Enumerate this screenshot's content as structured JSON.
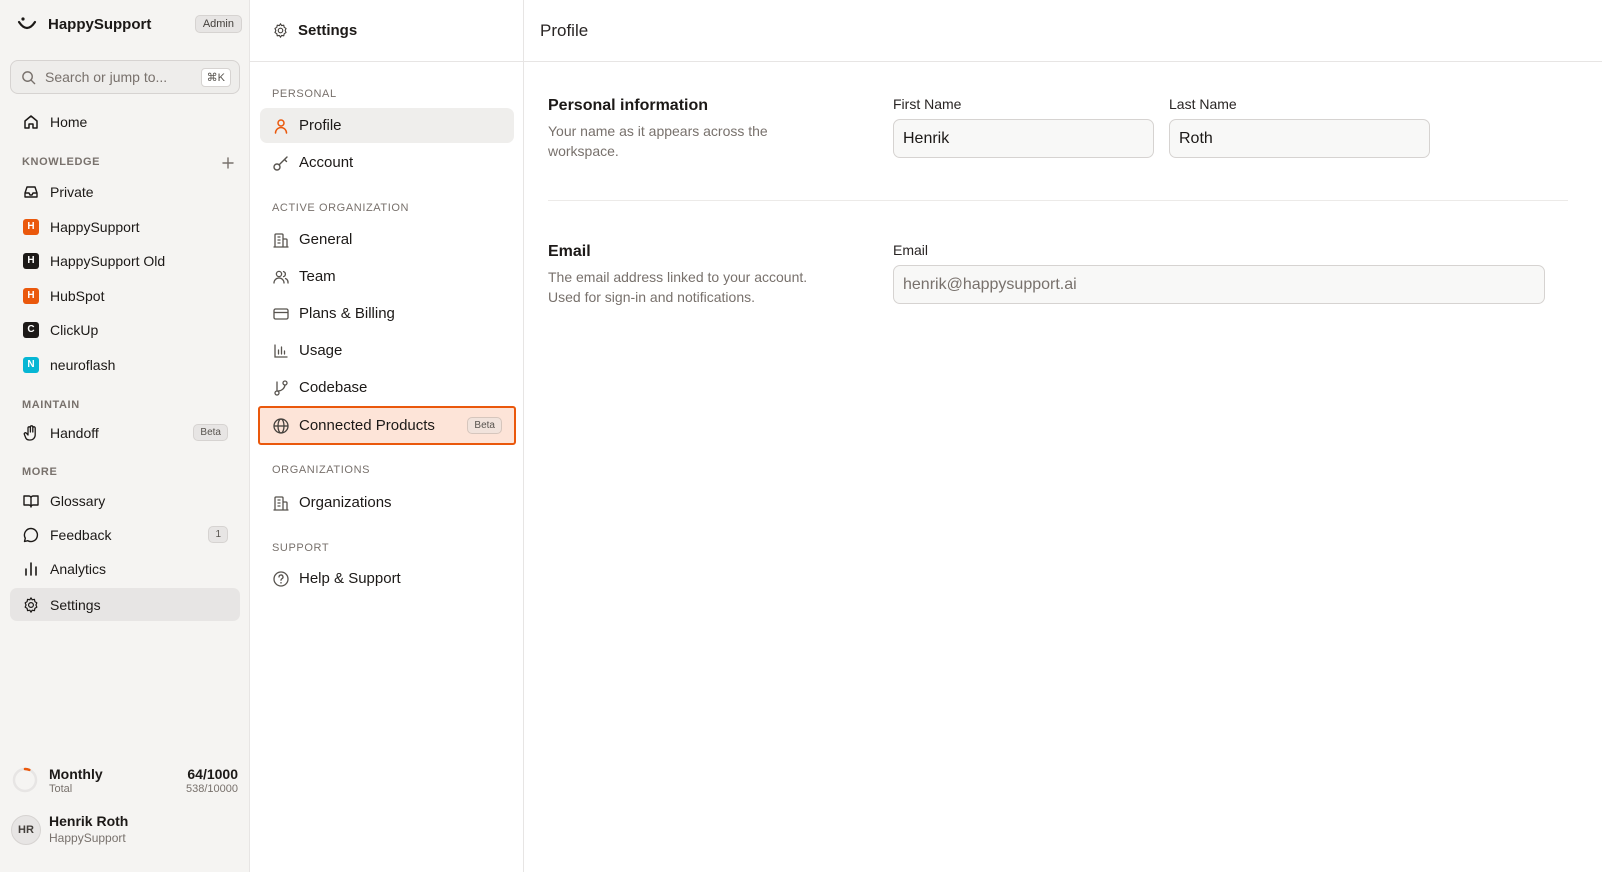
{
  "app": {
    "name": "HappySupport",
    "role_badge": "Admin"
  },
  "search": {
    "placeholder": "Search or jump to...",
    "shortcut": "⌘K"
  },
  "sidebar": {
    "home": "Home",
    "knowledge_label": "KNOWLEDGE",
    "knowledge": [
      {
        "label": "Private",
        "icon": "inbox-icon"
      },
      {
        "label": "HappySupport",
        "badge": "H",
        "color": "#ea580c"
      },
      {
        "label": "HappySupport Old",
        "badge": "H",
        "color": "#1c1917"
      },
      {
        "label": "HubSpot",
        "badge": "H",
        "color": "#ea580c"
      },
      {
        "label": "ClickUp",
        "badge": "C",
        "color": "#1c1917"
      },
      {
        "label": "neuroflash",
        "badge": "N",
        "color": "#06b6d4"
      }
    ],
    "maintain_label": "MAINTAIN",
    "handoff": "Handoff",
    "handoff_badge": "Beta",
    "more_label": "MORE",
    "glossary": "Glossary",
    "feedback": "Feedback",
    "feedback_count": "1",
    "analytics": "Analytics",
    "settings": "Settings"
  },
  "usage": {
    "title": "Monthly",
    "subtitle": "Total",
    "monthly": "64/1000",
    "total": "538/10000",
    "fraction": 0.064
  },
  "user": {
    "initials": "HR",
    "name": "Henrik Roth",
    "org": "HappySupport"
  },
  "settings_nav": {
    "title": "Settings",
    "personal_label": "PERSONAL",
    "profile": "Profile",
    "account": "Account",
    "active_org_label": "ACTIVE ORGANIZATION",
    "general": "General",
    "team": "Team",
    "billing": "Plans & Billing",
    "usage": "Usage",
    "codebase": "Codebase",
    "connected_products": "Connected Products",
    "connected_badge": "Beta",
    "organizations_label": "ORGANIZATIONS",
    "organizations": "Organizations",
    "support_label": "SUPPORT",
    "help": "Help & Support"
  },
  "main": {
    "title": "Profile",
    "personal": {
      "title": "Personal information",
      "description": "Your name as it appears across the workspace.",
      "first_name_label": "First Name",
      "first_name": "Henrik",
      "last_name_label": "Last Name",
      "last_name": "Roth"
    },
    "email": {
      "title": "Email",
      "description": "The email address linked to your account. Used for sign-in and notifications.",
      "label": "Email",
      "value": "henrik@happysupport.ai"
    }
  },
  "colors": {
    "accent": "#ea580c",
    "highlight_bg": "#fde4d8"
  }
}
